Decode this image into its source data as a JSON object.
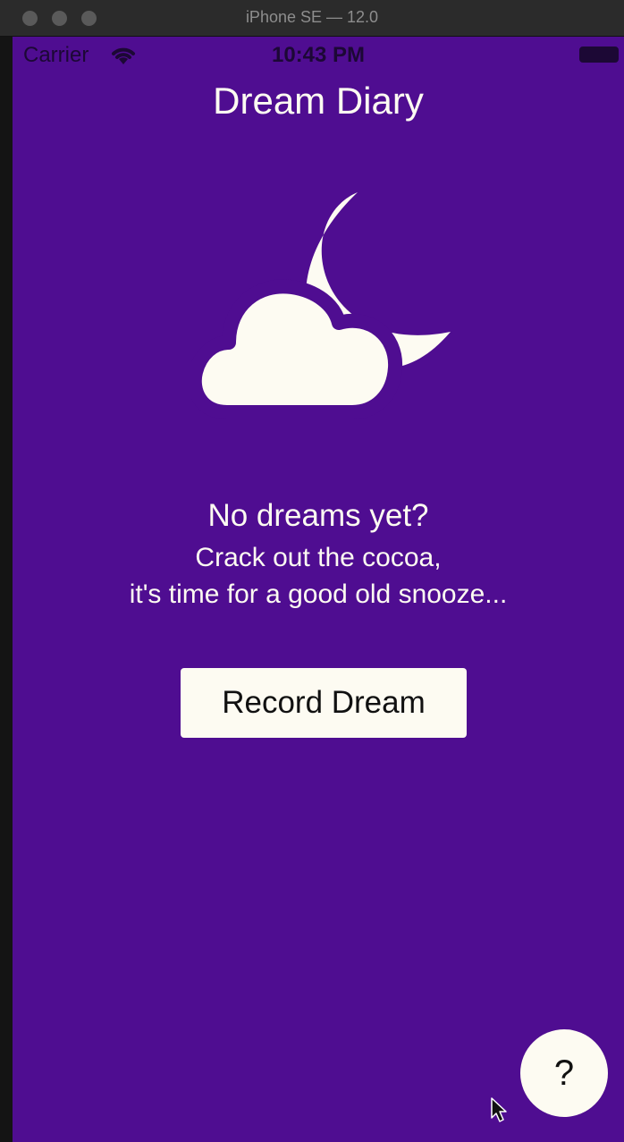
{
  "window": {
    "title": "iPhone SE — 12.0"
  },
  "statusbar": {
    "carrier": "Carrier",
    "time": "10:43 PM"
  },
  "app": {
    "title": "Dream Diary"
  },
  "empty_state": {
    "icon": "moon-cloud-icon",
    "headline": "No dreams yet?",
    "line1": "Crack out the cocoa,",
    "line2": "it's time for a good old snooze..."
  },
  "actions": {
    "record_label": "Record Dream",
    "help_label": "?"
  },
  "colors": {
    "background": "#4f0d91",
    "foreground": "#fdfbf2",
    "button_text": "#111111"
  }
}
